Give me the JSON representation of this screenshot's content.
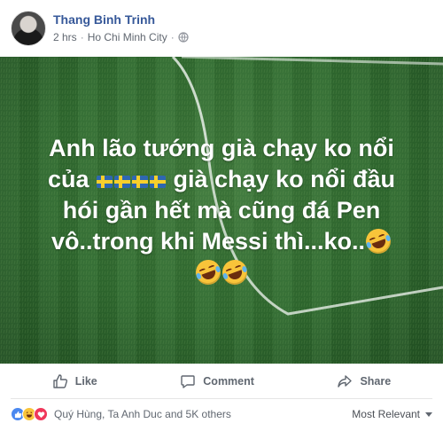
{
  "post": {
    "author": "Thang Binh Trinh",
    "time": "2 hrs",
    "location": "Ho Chi Minh City",
    "privacy_icon": "globe-icon"
  },
  "caption": {
    "line1": "Anh lão tướng già chạy ko nổi",
    "line2_pre": "của",
    "line2_post": "già chạy ko nổi đầu",
    "line3": "hói gần hết mà cũng đá Pen",
    "line4": "vô..trong khi Messi thì...ko.."
  },
  "actions": {
    "like": "Like",
    "comment": "Comment",
    "share": "Share"
  },
  "reactions": {
    "names": "Quý Hùng, Ta Anh Duc and 5K others",
    "sort": "Most Relevant",
    "types": [
      "like-icon",
      "haha-icon",
      "love-icon"
    ]
  },
  "colors": {
    "author_link": "#365899",
    "meta_text": "#606770",
    "grass": "#2f6a2f"
  }
}
